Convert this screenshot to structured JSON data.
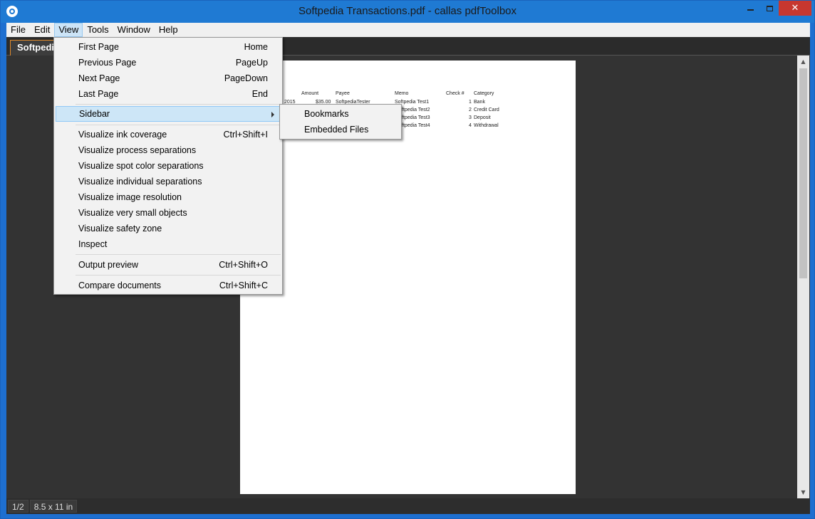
{
  "window": {
    "title": "Softpedia Transactions.pdf - callas pdfToolbox",
    "close_label": "✕"
  },
  "menubar": {
    "items": [
      "File",
      "Edit",
      "View",
      "Tools",
      "Window",
      "Help"
    ],
    "active": "View"
  },
  "document_tab": {
    "label": "Softpedia"
  },
  "view_menu": {
    "items": [
      {
        "label": "First Page",
        "shortcut": "Home"
      },
      {
        "label": "Previous Page",
        "shortcut": "PageUp"
      },
      {
        "label": "Next Page",
        "shortcut": "PageDown"
      },
      {
        "label": "Last Page",
        "shortcut": "End"
      },
      {
        "label": "Sidebar",
        "shortcut": "",
        "submenu": true,
        "highlighted": true
      },
      {
        "label": "Visualize ink coverage",
        "shortcut": "Ctrl+Shift+I"
      },
      {
        "label": "Visualize process separations",
        "shortcut": ""
      },
      {
        "label": "Visualize spot color separations",
        "shortcut": ""
      },
      {
        "label": "Visualize individual separations",
        "shortcut": ""
      },
      {
        "label": "Visualize image resolution",
        "shortcut": ""
      },
      {
        "label": "Visualize very small objects",
        "shortcut": ""
      },
      {
        "label": "Visualize safety zone",
        "shortcut": ""
      },
      {
        "label": "Inspect",
        "shortcut": ""
      },
      {
        "label": "Output preview",
        "shortcut": "Ctrl+Shift+O"
      },
      {
        "label": "Compare documents",
        "shortcut": "Ctrl+Shift+C"
      }
    ]
  },
  "sidebar_submenu": {
    "items": [
      "Bookmarks",
      "Embedded Files"
    ]
  },
  "pdf_page": {
    "headers": [
      "Amount",
      "Payee",
      "Memo",
      "Check #",
      "Category"
    ],
    "rows": [
      {
        "date_fragment": "2015",
        "amount": "$35.00",
        "payee": "SoftpediaTester",
        "memo": "Softpedia Test1",
        "check": "1",
        "category": "Bank"
      },
      {
        "date_fragment": "",
        "amount": "",
        "payee": "",
        "memo": "ftpedia Test2",
        "check": "2",
        "category": "Credit Card"
      },
      {
        "date_fragment": "",
        "amount": "",
        "payee": "",
        "memo": "ftpedia Test3",
        "check": "3",
        "category": "Deposit"
      },
      {
        "date_fragment": "",
        "amount": "",
        "payee": "",
        "memo": "ftpedia Test4",
        "check": "4",
        "category": "Withdrawal"
      }
    ]
  },
  "statusbar": {
    "page": "1/2",
    "size": "8.5 x 11 in"
  }
}
